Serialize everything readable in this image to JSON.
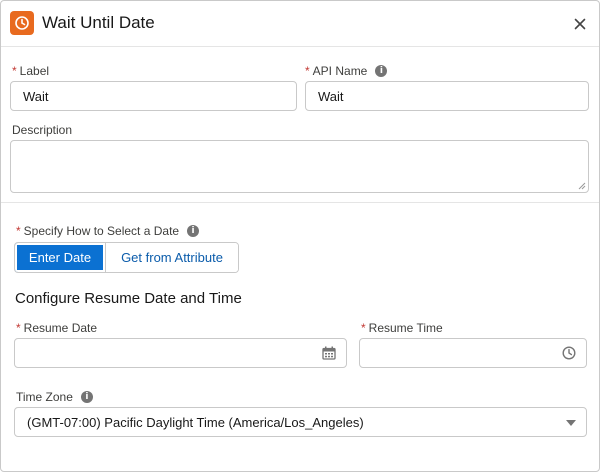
{
  "header": {
    "title": "Wait Until Date",
    "icon": "clock-icon",
    "accent_color": "#e86a1f"
  },
  "fields": {
    "label": {
      "label": "Label",
      "required": "*",
      "value": "Wait"
    },
    "api_name": {
      "label": "API Name",
      "required": "*",
      "value": "Wait"
    },
    "description": {
      "label": "Description",
      "value": ""
    }
  },
  "date_selection": {
    "label": "Specify How to Select a Date",
    "required": "*",
    "options": [
      "Enter Date",
      "Get from Attribute"
    ],
    "selected": "Enter Date"
  },
  "resume": {
    "section_title": "Configure Resume Date and Time",
    "date": {
      "label": "Resume Date",
      "required": "*",
      "value": ""
    },
    "time": {
      "label": "Resume Time",
      "required": "*",
      "value": ""
    }
  },
  "time_zone": {
    "label": "Time Zone",
    "value": "(GMT-07:00) Pacific Daylight Time (America/Los_Angeles)"
  },
  "colors": {
    "brand_blue": "#0b71d2",
    "link_blue": "#0b5cab",
    "required_red": "#c23934"
  }
}
